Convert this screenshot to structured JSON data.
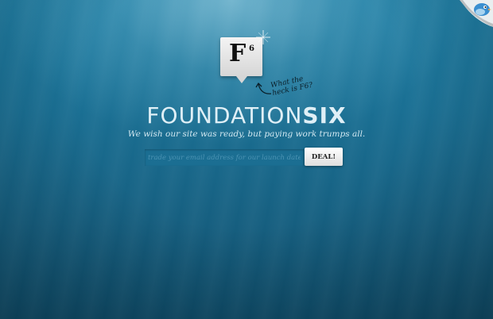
{
  "logo": {
    "letter": "F",
    "superscript": "6",
    "note": "What the heck is F6?"
  },
  "title": {
    "part1": "FOUNDATION",
    "part2": "SIX"
  },
  "tagline": "We wish our site was ready, but paying work trumps all.",
  "signup": {
    "placeholder": "trade your email address for our launch date?",
    "button_label": "DEAL!"
  },
  "corner": {
    "icon": "twitter-bird-icon"
  },
  "colors": {
    "background_top": "#1f7da3",
    "background_bottom": "#0f4d6a",
    "title": "#dfeff6",
    "input_bg": "#1b6e92"
  }
}
